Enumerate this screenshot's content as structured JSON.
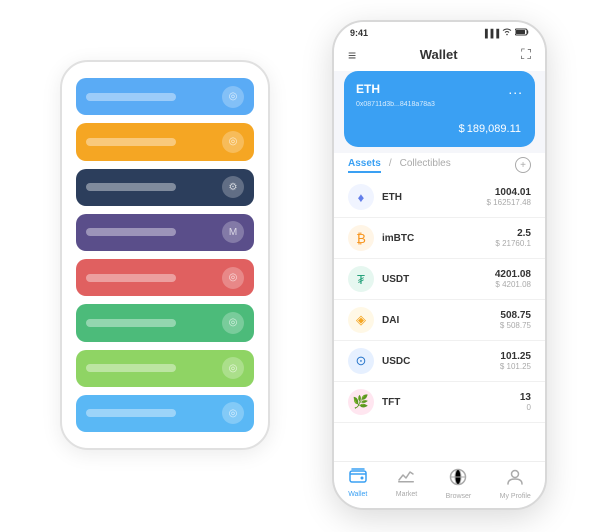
{
  "background_phone": {
    "cards": [
      {
        "color": "card-blue",
        "icon": "◎"
      },
      {
        "color": "card-orange",
        "icon": "◎"
      },
      {
        "color": "card-dark",
        "icon": "⚙"
      },
      {
        "color": "card-purple",
        "icon": "M"
      },
      {
        "color": "card-red",
        "icon": "◎"
      },
      {
        "color": "card-green",
        "icon": "◎"
      },
      {
        "color": "card-light-green",
        "icon": "◎"
      },
      {
        "color": "card-light-blue",
        "icon": "◎"
      }
    ]
  },
  "status_bar": {
    "time": "9:41",
    "signal": "▐▐▐",
    "wifi": "wifi",
    "battery": "battery"
  },
  "header": {
    "title": "Wallet",
    "hamburger": "≡",
    "expand": "⇱"
  },
  "eth_card": {
    "label": "ETH",
    "dots": "...",
    "address": "0x08711d3b...8418a78a3",
    "currency_symbol": "$",
    "balance": "189,089.11"
  },
  "tabs": [
    {
      "label": "Assets",
      "active": true
    },
    {
      "label": "/",
      "active": false
    },
    {
      "label": "Collectibles",
      "active": false
    }
  ],
  "assets": [
    {
      "symbol": "ETH",
      "icon_char": "♦",
      "icon_class": "asset-icon-eth",
      "amount": "1004.01",
      "usd": "$ 162517.48"
    },
    {
      "symbol": "imBTC",
      "icon_char": "₿",
      "icon_class": "asset-icon-imbtc",
      "amount": "2.5",
      "usd": "$ 21760.1"
    },
    {
      "symbol": "USDT",
      "icon_char": "₮",
      "icon_class": "asset-icon-usdt",
      "amount": "4201.08",
      "usd": "$ 4201.08"
    },
    {
      "symbol": "DAI",
      "icon_char": "◈",
      "icon_class": "asset-icon-dai",
      "amount": "508.75",
      "usd": "$ 508.75"
    },
    {
      "symbol": "USDC",
      "icon_char": "⊙",
      "icon_class": "asset-icon-usdc",
      "amount": "101.25",
      "usd": "$ 101.25"
    },
    {
      "symbol": "TFT",
      "icon_char": "🌿",
      "icon_class": "asset-icon-tft",
      "amount": "13",
      "usd": "0"
    }
  ],
  "bottom_nav": [
    {
      "label": "Wallet",
      "icon": "◎",
      "active": true
    },
    {
      "label": "Market",
      "icon": "📈",
      "active": false
    },
    {
      "label": "Browser",
      "icon": "🌐",
      "active": false
    },
    {
      "label": "My Profile",
      "icon": "👤",
      "active": false
    }
  ]
}
